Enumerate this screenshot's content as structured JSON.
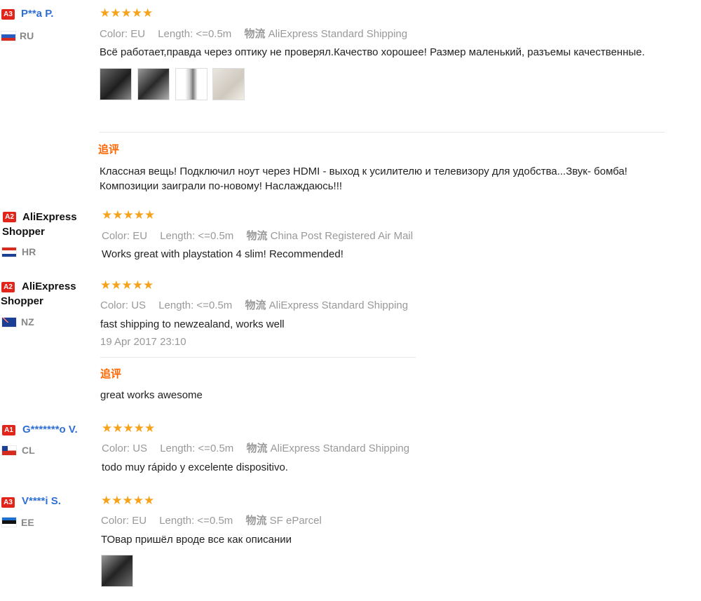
{
  "labels": {
    "color": "Color:",
    "length": "Length:",
    "shipping": "物流",
    "followup": "追评"
  },
  "stars": "★★★★★",
  "reviews": [
    {
      "badge": "A3",
      "name": "P**a P.",
      "country": "RU",
      "rating": 5,
      "color": "EU",
      "length": "<=0.5m",
      "shipping": "AliExpress Standard Shipping",
      "text": "Всё работает,правда через оптику не проверял.Качество хорошее! Размер маленький, разъемы качественные.",
      "followup_text": "Классная вещь! Подключил ноут через HDMI - выход к усилителю и телевизору для удобства...Звук- бомба! Композиции заиграли по-новому! Наслаждаюсь!!!"
    },
    {
      "badge": "A2",
      "name": "AliExpress Shopper",
      "country": "HR",
      "rating": 5,
      "color": "EU",
      "length": "<=0.5m",
      "shipping": "China Post Registered Air Mail",
      "text": "Works great with playstation 4 slim! Recommended!"
    },
    {
      "badge": "A2",
      "name": "AliExpress Shopper",
      "country": "NZ",
      "rating": 5,
      "color": "US",
      "length": "<=0.5m",
      "shipping": "AliExpress Standard Shipping",
      "text": "fast shipping to newzealand, works well",
      "date": "19 Apr 2017 23:10",
      "followup_text": "great works awesome"
    },
    {
      "badge": "A1",
      "name": "G*******o V.",
      "country": "CL",
      "rating": 5,
      "color": "US",
      "length": "<=0.5m",
      "shipping": "AliExpress Standard Shipping",
      "text": "todo muy rápido y excelente dispositivo."
    },
    {
      "badge": "A3",
      "name": "V****i S.",
      "country": "EE",
      "rating": 5,
      "color": "EU",
      "length": "<=0.5m",
      "shipping": "SF eParcel",
      "text": "ТОвар пришёл вроде все как описании"
    }
  ],
  "colors": {
    "accent_orange": "#ff6600",
    "star": "#f7a21b",
    "link_blue": "#2f6fd6",
    "badge_red": "#e1251b"
  }
}
